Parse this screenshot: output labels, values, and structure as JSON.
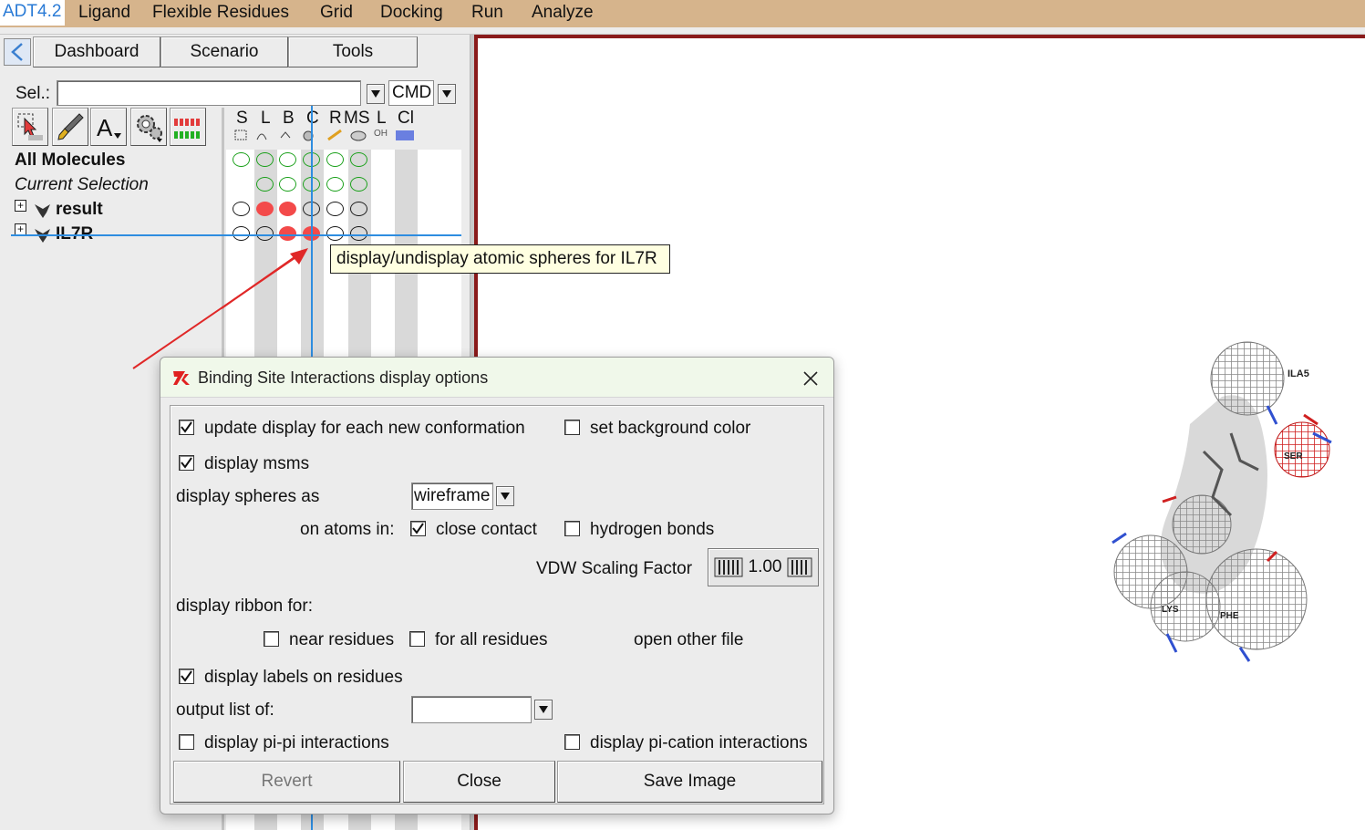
{
  "app": {
    "title": "ADT4.2"
  },
  "menu": [
    "Ligand",
    "Flexible Residues",
    "Grid",
    "Docking",
    "Run",
    "Analyze"
  ],
  "tabs": [
    "Dashboard",
    "Scenario",
    "Tools"
  ],
  "selection": {
    "label": "Sel.:",
    "value": "",
    "cmd": "CMD"
  },
  "columns": {
    "headers": [
      "S",
      "L",
      "B",
      "C",
      "R",
      "MS",
      "L",
      "Cl"
    ],
    "sub_oh": "OH"
  },
  "tree": {
    "all_molecules": "All Molecules",
    "current_selection": "Current Selection",
    "mol1": "result",
    "mol2": "IL7R"
  },
  "tooltip": "display/undisplay atomic spheres for IL7R",
  "dialog": {
    "title": "Binding Site Interactions display options",
    "update_display": "update display for each new conformation",
    "update_display_checked": true,
    "set_bg": "set background color",
    "set_bg_checked": false,
    "display_msms": "display msms",
    "display_msms_checked": true,
    "spheres_label": "display spheres as",
    "spheres_value": "wireframe",
    "on_atoms_in": "on atoms in:",
    "close_contact": "close contact",
    "close_contact_checked": true,
    "hbonds": "hydrogen bonds",
    "hbonds_checked": false,
    "vdw_label": "VDW Scaling Factor",
    "vdw_value": "1.00",
    "ribbon_label": "display ribbon for:",
    "near_residues": "near residues",
    "near_checked": false,
    "all_residues": "for all residues",
    "all_checked": false,
    "open_other": "open other file",
    "labels_on_residues": "display labels on residues",
    "labels_checked": true,
    "output_list": "output list of:",
    "output_value": "",
    "pipi": "display pi-pi interactions",
    "pipi_checked": false,
    "pication": "display pi-cation interactions",
    "pication_checked": false,
    "btn_revert": "Revert",
    "btn_close": "Close",
    "btn_save": "Save Image"
  },
  "viewer": {
    "residue_labels": [
      "ILA5",
      "SER",
      "LYS",
      "PHE"
    ]
  }
}
